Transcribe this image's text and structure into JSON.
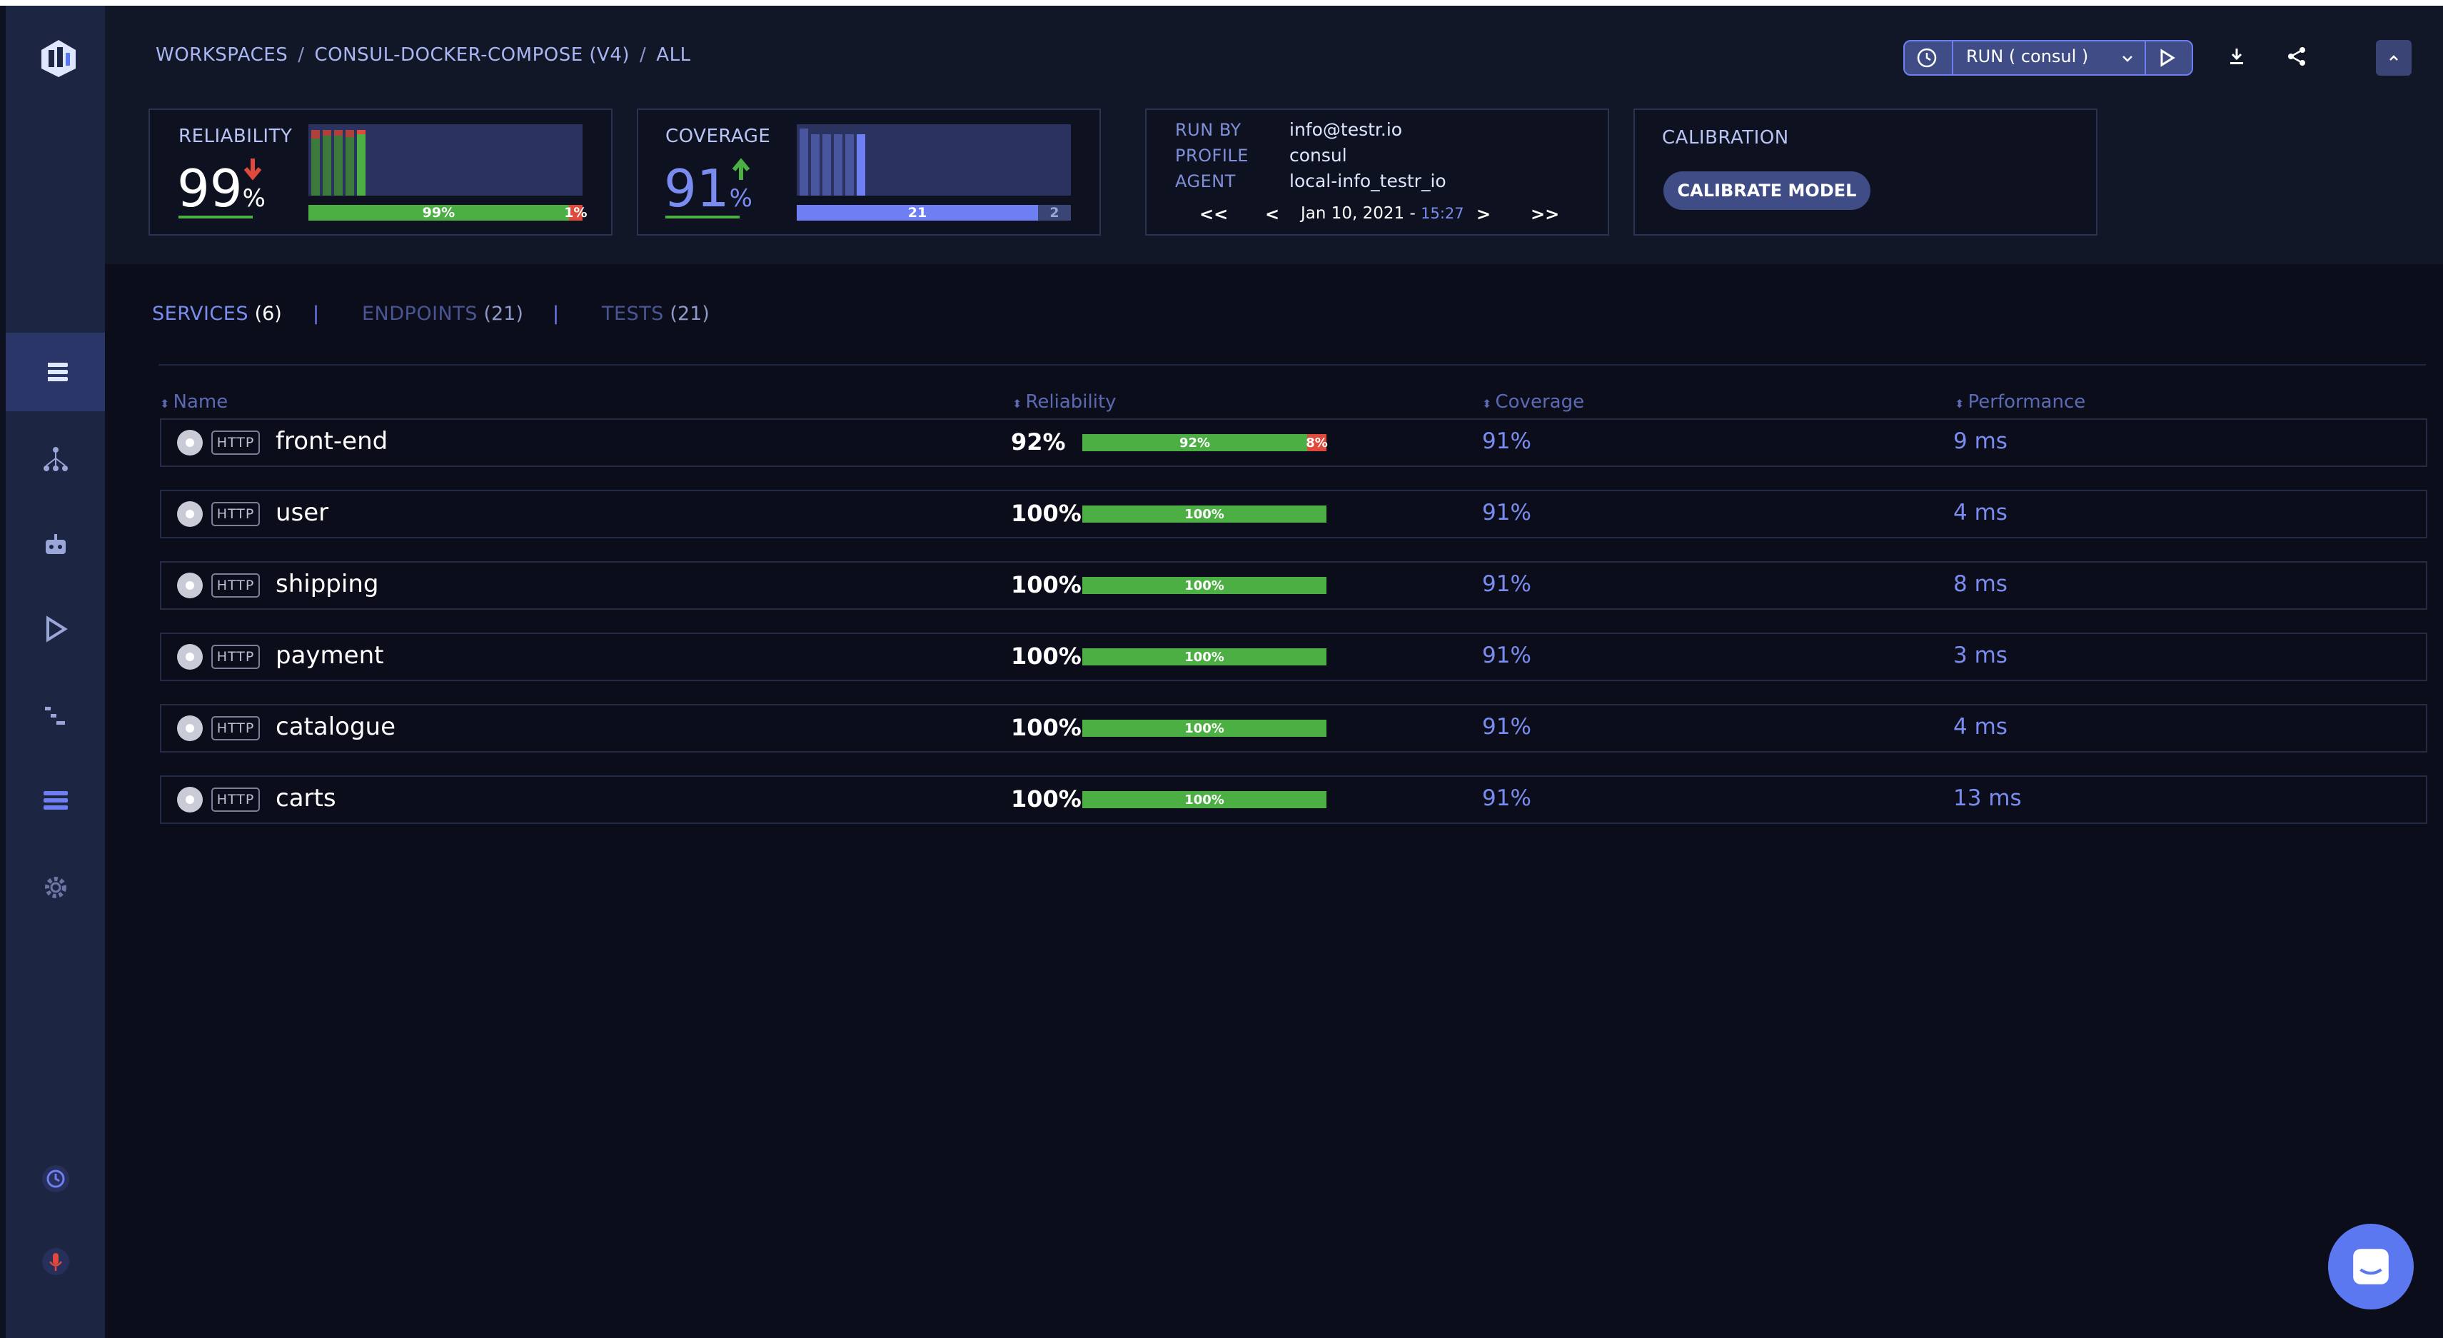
{
  "breadcrumb": [
    "WORKSPACES",
    "CONSUL-DOCKER-COMPOSE (V4)",
    "ALL"
  ],
  "toolbar": {
    "run_label": "RUN ( consul )"
  },
  "reliability_card": {
    "label": "RELIABILITY",
    "value": "99",
    "unit": "%",
    "pass_label": "99%",
    "fail_label": "1%",
    "pass_fraction": 0.99
  },
  "coverage_card": {
    "label": "COVERAGE",
    "value": "91",
    "unit": "%",
    "covered_label": "21",
    "uncovered_label": "2",
    "covered_fraction": 0.913
  },
  "run_info": {
    "run_by_key": "RUN BY",
    "run_by": "info@testr.io",
    "profile_key": "PROFILE",
    "profile": "consul",
    "agent_key": "AGENT",
    "agent": "local-info_testr_io",
    "nav_first": "<<",
    "nav_prev": "<",
    "date": "Jan 10, 2021 - ",
    "time": "15:27",
    "nav_next": ">",
    "nav_last": ">>"
  },
  "calibration": {
    "label": "CALIBRATION",
    "button": "CALIBRATE MODEL"
  },
  "tabs": [
    {
      "label": "SERVICES",
      "count": "(6)"
    },
    {
      "label": "ENDPOINTS",
      "count": "(21)"
    },
    {
      "label": "TESTS",
      "count": "(21)"
    }
  ],
  "tab_sep": "|",
  "columns": {
    "name": "Name",
    "reliability": "Reliability",
    "coverage": "Coverage",
    "performance": "Performance"
  },
  "rows": [
    {
      "tag": "HTTP",
      "name": "front-end",
      "reliability": "92%",
      "pass_label": "92%",
      "fail_label": "8%",
      "pass_fraction": 0.92,
      "coverage": "91%",
      "performance": "9 ms"
    },
    {
      "tag": "HTTP",
      "name": "user",
      "reliability": "100%",
      "pass_label": "100%",
      "fail_label": "",
      "pass_fraction": 1.0,
      "coverage": "91%",
      "performance": "4 ms"
    },
    {
      "tag": "HTTP",
      "name": "shipping",
      "reliability": "100%",
      "pass_label": "100%",
      "fail_label": "",
      "pass_fraction": 1.0,
      "coverage": "91%",
      "performance": "8 ms"
    },
    {
      "tag": "HTTP",
      "name": "payment",
      "reliability": "100%",
      "pass_label": "100%",
      "fail_label": "",
      "pass_fraction": 1.0,
      "coverage": "91%",
      "performance": "3 ms"
    },
    {
      "tag": "HTTP",
      "name": "catalogue",
      "reliability": "100%",
      "pass_label": "100%",
      "fail_label": "",
      "pass_fraction": 1.0,
      "coverage": "91%",
      "performance": "4 ms"
    },
    {
      "tag": "HTTP",
      "name": "carts",
      "reliability": "100%",
      "pass_label": "100%",
      "fail_label": "",
      "pass_fraction": 1.0,
      "coverage": "91%",
      "performance": "13 ms"
    }
  ],
  "colors": {
    "pass": "#4caf43",
    "fail": "#e04a3c",
    "accent": "#6d7ff2",
    "sidebar": "#1c2541"
  },
  "icons": [
    "logo-icon",
    "services-list-icon",
    "topology-icon",
    "robot-icon",
    "run-icon",
    "steps-icon",
    "list-icon",
    "gear-icon",
    "history-icon",
    "mic-icon",
    "clock-icon",
    "chevron-down-icon",
    "play-icon",
    "download-icon",
    "share-icon",
    "collapse-icon",
    "chat-icon"
  ]
}
